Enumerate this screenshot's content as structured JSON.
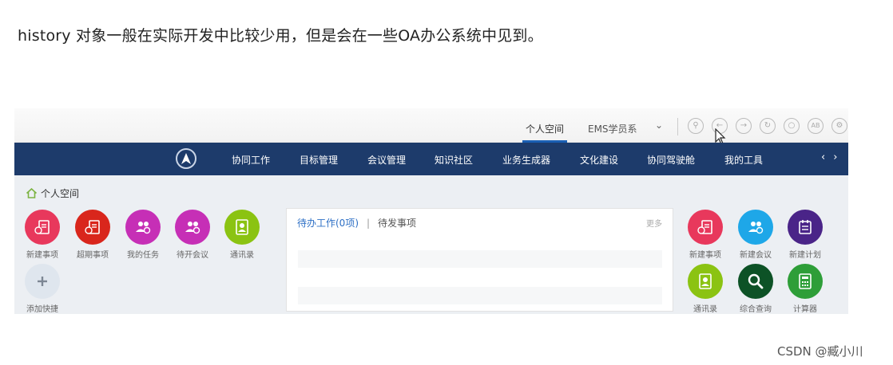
{
  "article": {
    "text": "history 对象一般在实际开发中比较少用，但是会在一些OA办公系统中见到。"
  },
  "topbar": {
    "space_tab": "个人空间",
    "user": "EMS学员系",
    "icons": [
      "search-icon",
      "back-icon",
      "forward-icon",
      "refresh-icon",
      "chat-icon",
      "ab-icon",
      "settings-icon"
    ]
  },
  "nav": {
    "items": [
      "协同工作",
      "目标管理",
      "会议管理",
      "知识社区",
      "业务生成器",
      "文化建设",
      "协同驾驶舱",
      "我的工具"
    ]
  },
  "breadcrumb": {
    "label": "个人空间"
  },
  "left_apps": [
    {
      "label": "新建事项",
      "color": "#e8385c",
      "icon": "new-item-icon"
    },
    {
      "label": "超期事项",
      "color": "#d9261c",
      "icon": "overdue-icon"
    },
    {
      "label": "我的任务",
      "color": "#c62fb6",
      "icon": "tasks-icon"
    },
    {
      "label": "待开会议",
      "color": "#c62fb6",
      "icon": "meeting-icon"
    },
    {
      "label": "通讯录",
      "color": "#8bc312",
      "icon": "contacts-icon"
    },
    {
      "label": "添加快捷",
      "color": "#dfe6ee",
      "icon": "plus-icon"
    }
  ],
  "todo": {
    "tab_active": "待办工作(0项)",
    "separator": "|",
    "tab_other": "待发事项",
    "more": "更多"
  },
  "right_apps": [
    {
      "label": "新建事项",
      "color": "#e8385c",
      "icon": "new-item-icon"
    },
    {
      "label": "新建会议",
      "color": "#1ea7e8",
      "icon": "new-meeting-icon"
    },
    {
      "label": "新建计划",
      "color": "#4a2488",
      "icon": "new-plan-icon"
    },
    {
      "label": "通讯录",
      "color": "#8bc312",
      "icon": "contacts-icon"
    },
    {
      "label": "综合查询",
      "color": "#0d5226",
      "icon": "search-icon"
    },
    {
      "label": "计算器",
      "color": "#2e9e38",
      "icon": "calculator-icon"
    }
  ],
  "watermark": "CSDN @臧小川"
}
